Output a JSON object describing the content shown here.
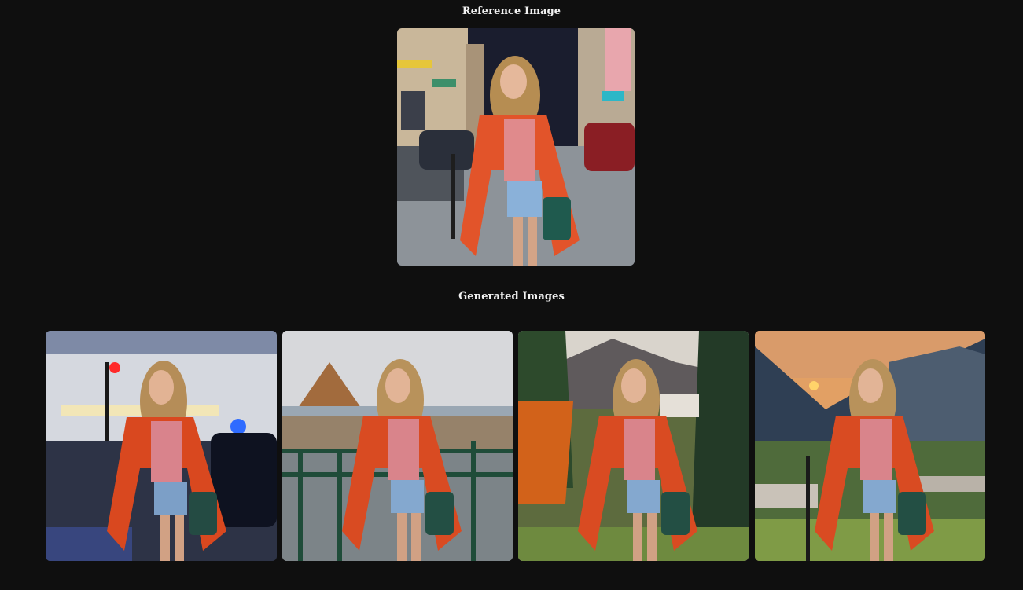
{
  "reference_section": {
    "heading": "Reference Image"
  },
  "generated_section": {
    "heading": "Generated Images"
  }
}
